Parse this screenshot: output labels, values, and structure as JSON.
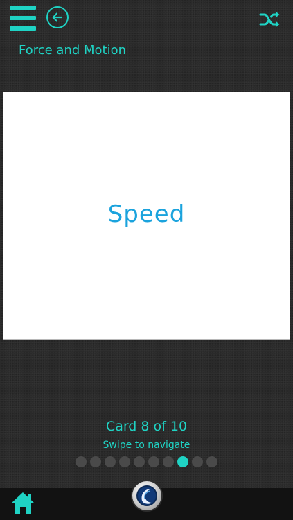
{
  "header": {
    "deck_title": "Force and Motion"
  },
  "card": {
    "term": "Speed"
  },
  "progress": {
    "counter_text": "Card 8 of 10",
    "hint_text": "Swipe to navigate",
    "current": 8,
    "total": 10
  },
  "icons": {
    "menu": "menu-icon",
    "back": "arrow-left-circle-icon",
    "shuffle": "shuffle-icon",
    "home": "home-icon",
    "logo": "app-logo-icon"
  },
  "colors": {
    "accent": "#1fd3c4",
    "term": "#1ba3dd",
    "background": "#2a2a2a",
    "dot_inactive": "#4a4a4a",
    "bottom_bar": "#121212"
  }
}
